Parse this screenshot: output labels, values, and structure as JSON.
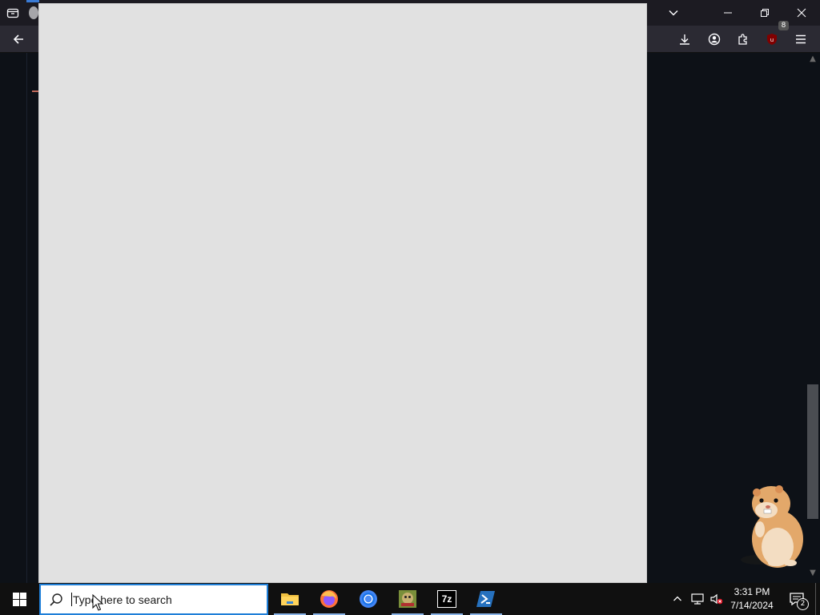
{
  "browser": {
    "toolbar": {
      "extensions_badge": "8"
    }
  },
  "taskbar": {
    "search": {
      "placeholder": "Type here to search"
    },
    "apps": [
      {
        "name": "file-explorer",
        "running": true
      },
      {
        "name": "firefox",
        "running": true
      },
      {
        "name": "chrome",
        "running": false
      },
      {
        "name": "game-launcher",
        "running": true
      },
      {
        "name": "7-zip",
        "running": true
      },
      {
        "name": "powershell",
        "running": true
      }
    ],
    "apps_labels": {
      "seven_zip": "7z"
    },
    "clock": {
      "time": "3:31 PM",
      "date": "7/14/2024"
    },
    "notifications": {
      "count": "2"
    }
  },
  "colors": {
    "accent": "#1f7fd8",
    "content_bg": "#0d1117",
    "dialog_bg": "#e1e1e1",
    "taskbar_bg": "#101010"
  }
}
